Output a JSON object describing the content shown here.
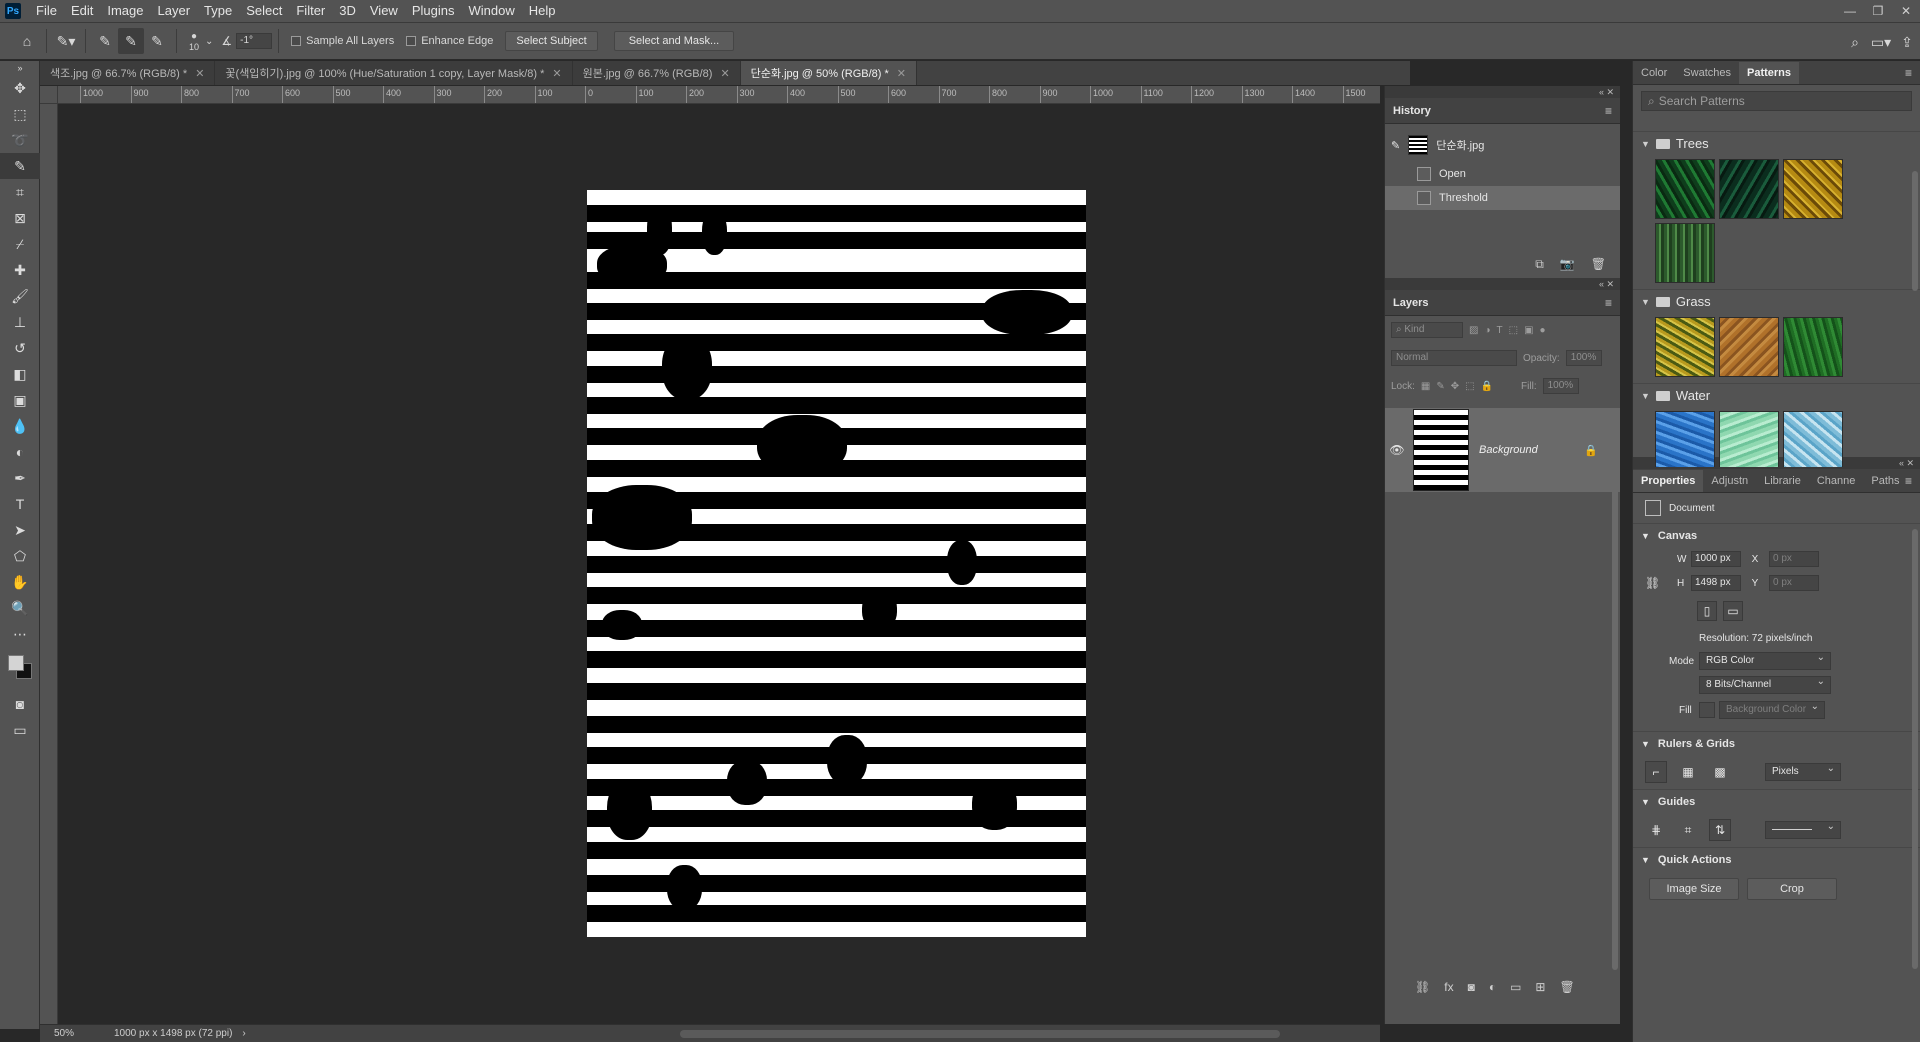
{
  "menubar": {
    "logo": "Ps",
    "items": [
      "File",
      "Edit",
      "Image",
      "Layer",
      "Type",
      "Select",
      "Filter",
      "3D",
      "View",
      "Plugins",
      "Window",
      "Help"
    ]
  },
  "options": {
    "brush_size": "10",
    "angle_value": "-1°",
    "sample_all_layers": "Sample All Layers",
    "enhance_edge": "Enhance Edge",
    "select_subject": "Select Subject",
    "select_and_mask": "Select and Mask..."
  },
  "doc_tabs": [
    {
      "label": "색조.jpg @ 66.7% (RGB/8) *",
      "active": false
    },
    {
      "label": "꽃(색입히기).jpg @ 100% (Hue/Saturation 1 copy, Layer Mask/8) *",
      "active": false
    },
    {
      "label": "원본.jpg @ 66.7% (RGB/8)",
      "active": false
    },
    {
      "label": "단순화.jpg @ 50% (RGB/8) *",
      "active": true
    }
  ],
  "ruler_labels": [
    "1000",
    "900",
    "800",
    "700",
    "600",
    "500",
    "400",
    "300",
    "200",
    "100",
    "0",
    "100",
    "200",
    "300",
    "400",
    "500",
    "600",
    "700",
    "800",
    "900",
    "1000",
    "1100",
    "1200",
    "1300",
    "1400",
    "1500"
  ],
  "status": {
    "zoom": "50%",
    "doc_info": "1000 px x 1498 px (72 ppi)"
  },
  "history": {
    "title": "History",
    "snapshot_name": "단순화.jpg",
    "steps": [
      "Open",
      "Threshold"
    ]
  },
  "layers": {
    "title": "Layers",
    "kind_placeholder": "Kind",
    "blend_mode": "Normal",
    "opacity_label": "Opacity:",
    "opacity_value": "100%",
    "lock_label": "Lock:",
    "fill_label": "Fill:",
    "fill_value": "100%",
    "layer_name": "Background"
  },
  "patterns": {
    "tabs": [
      "Color",
      "Swatches",
      "Patterns"
    ],
    "search_placeholder": "Search Patterns",
    "groups": [
      "Trees",
      "Grass",
      "Water"
    ]
  },
  "properties": {
    "tabs": [
      "Properties",
      "Adjustn",
      "Librarie",
      "Channe",
      "Paths"
    ],
    "doc_label": "Document",
    "canvas_title": "Canvas",
    "w_label": "W",
    "w_value": "1000 px",
    "h_label": "H",
    "h_value": "1498 px",
    "x_label": "X",
    "x_value": "0 px",
    "y_label": "Y",
    "y_value": "0 px",
    "resolution": "Resolution: 72 pixels/inch",
    "mode_label": "Mode",
    "mode_value": "RGB Color",
    "bits_value": "8 Bits/Channel",
    "fill_label": "Fill",
    "fill_value": "Background Color",
    "rulers_title": "Rulers & Grids",
    "units_value": "Pixels",
    "guides_title": "Guides",
    "quick_actions_title": "Quick Actions",
    "image_size": "Image Size",
    "crop": "Crop"
  }
}
